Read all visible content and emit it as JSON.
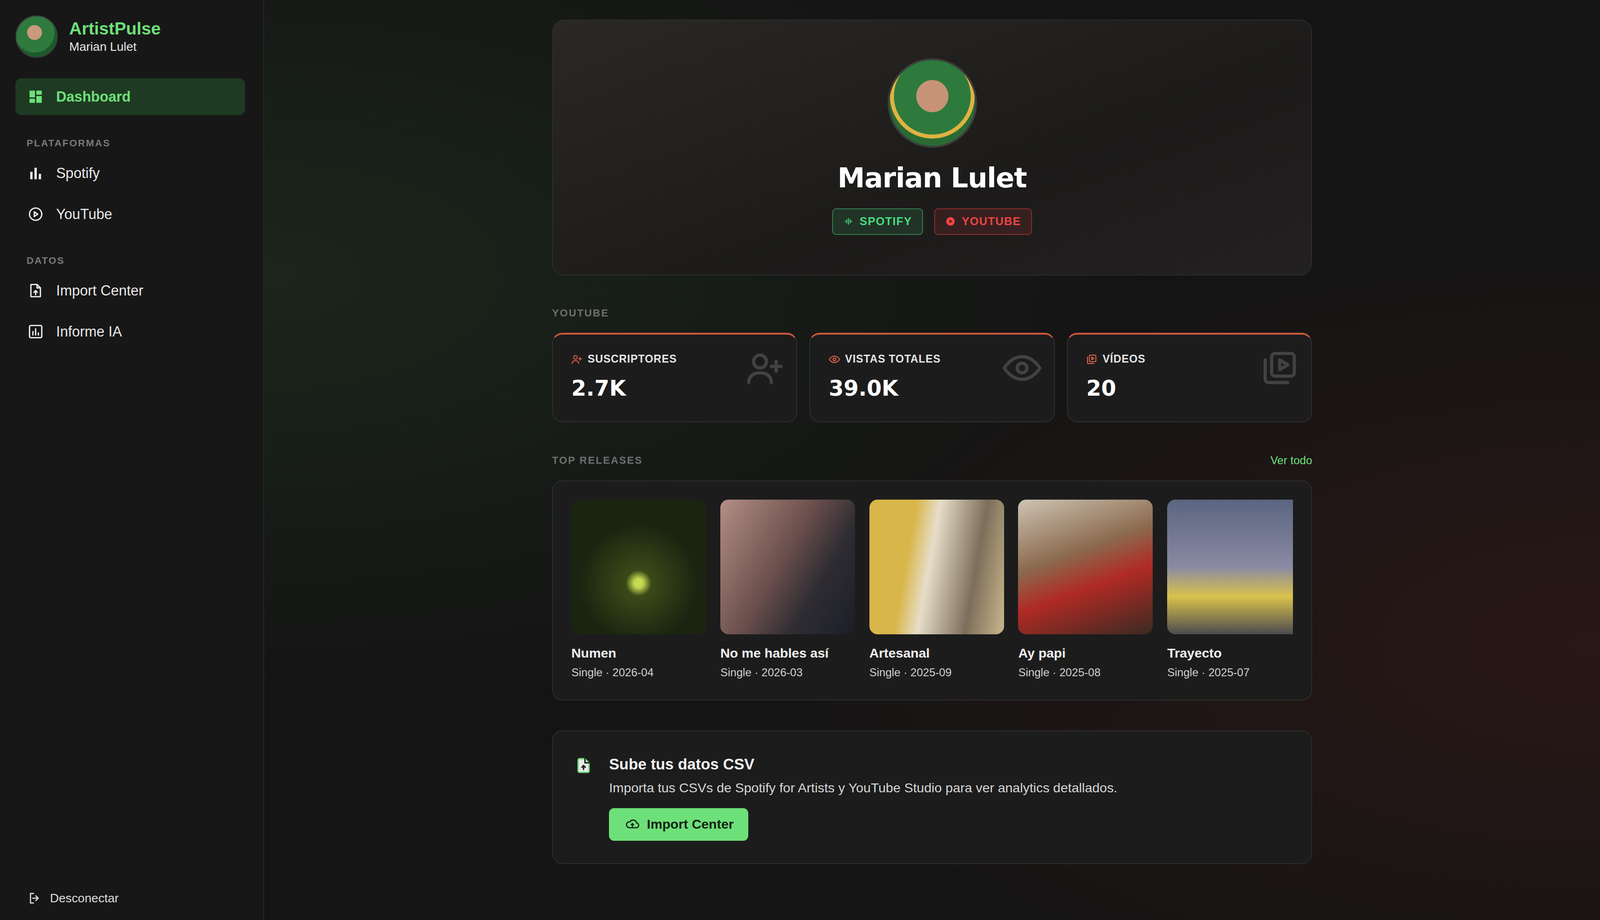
{
  "app": {
    "name": "ArtistPulse",
    "user": "Marian Lulet"
  },
  "sidebar": {
    "items": [
      {
        "label": "Dashboard",
        "selected": true
      }
    ],
    "sections": [
      {
        "title": "PLATAFORMAS",
        "items": [
          {
            "label": "Spotify",
            "selected": false
          },
          {
            "label": "YouTube",
            "selected": false
          }
        ]
      },
      {
        "title": "DATOS",
        "items": [
          {
            "label": "Import Center",
            "selected": false
          },
          {
            "label": "Informe IA",
            "selected": false
          }
        ]
      }
    ],
    "logout": "Desconectar"
  },
  "profile": {
    "name": "Marian Lulet",
    "platforms": [
      {
        "label": "SPOTIFY",
        "color": "#4ade80"
      },
      {
        "label": "YOUTUBE",
        "color": "#ef4444"
      }
    ]
  },
  "youtube": {
    "title": "YOUTUBE",
    "stats": [
      {
        "label": "SUSCRIPTORES",
        "value": "2.7K"
      },
      {
        "label": "VISTAS TOTALES",
        "value": "39.0K"
      },
      {
        "label": "VÍDEOS",
        "value": "20"
      }
    ]
  },
  "releases": {
    "title": "TOP RELEASES",
    "link": "Ver todo",
    "items": [
      {
        "title": "Numen",
        "meta": "Single · 2026-04"
      },
      {
        "title": "No me hables así",
        "meta": "Single · 2026-03"
      },
      {
        "title": "Artesanal",
        "meta": "Single · 2025-09"
      },
      {
        "title": "Ay papi",
        "meta": "Single · 2025-08"
      },
      {
        "title": "Trayecto",
        "meta": "Single · 2025-07"
      }
    ]
  },
  "import": {
    "title": "Sube tus datos CSV",
    "description": "Importa tus CSVs de Spotify for Artists y YouTube Studio para ver analytics detallados.",
    "button": "Import Center"
  }
}
